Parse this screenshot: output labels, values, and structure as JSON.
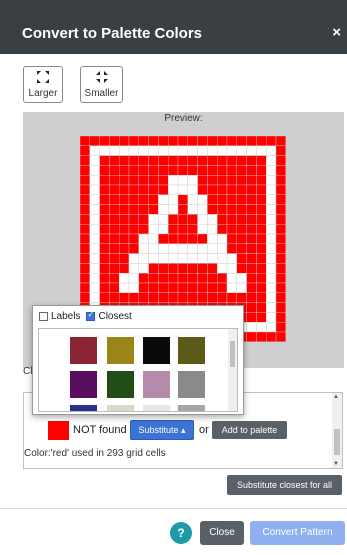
{
  "dialog": {
    "title": "Convert to Palette Colors",
    "close_glyph": "×"
  },
  "size_buttons": {
    "larger": "Larger",
    "smaller": "Smaller"
  },
  "preview": {
    "label": "Preview:",
    "colors": {
      "red": "#ff0000",
      "white": "#ffffff"
    }
  },
  "cut_label": "Cl",
  "color_row": {
    "swatch_color": "#ff0000",
    "not_found": "NOT found",
    "substitute": "Substitute ▴",
    "or": "or",
    "add_to_palette": "Add to palette",
    "usage": "Color:'red' used in 293 grid cells"
  },
  "substitute_all": "Substitute closest for all",
  "footer": {
    "help": "?",
    "close": "Close",
    "convert": "Convert Pattern"
  },
  "popup": {
    "labels_option": "Labels",
    "labels_checked": false,
    "closest_option": "Closest",
    "closest_checked": true,
    "swatches": [
      [
        "#8b2433",
        "#9c8518",
        "#0a0a0a",
        "#5c5a18"
      ],
      [
        "#5a0f5e",
        "#1f4d15",
        "#b48bab",
        "#8a8a8a"
      ],
      [
        "#2c2f8a",
        "#d9d9c9",
        "#e6e6e6",
        "#a6a6a6"
      ]
    ]
  }
}
